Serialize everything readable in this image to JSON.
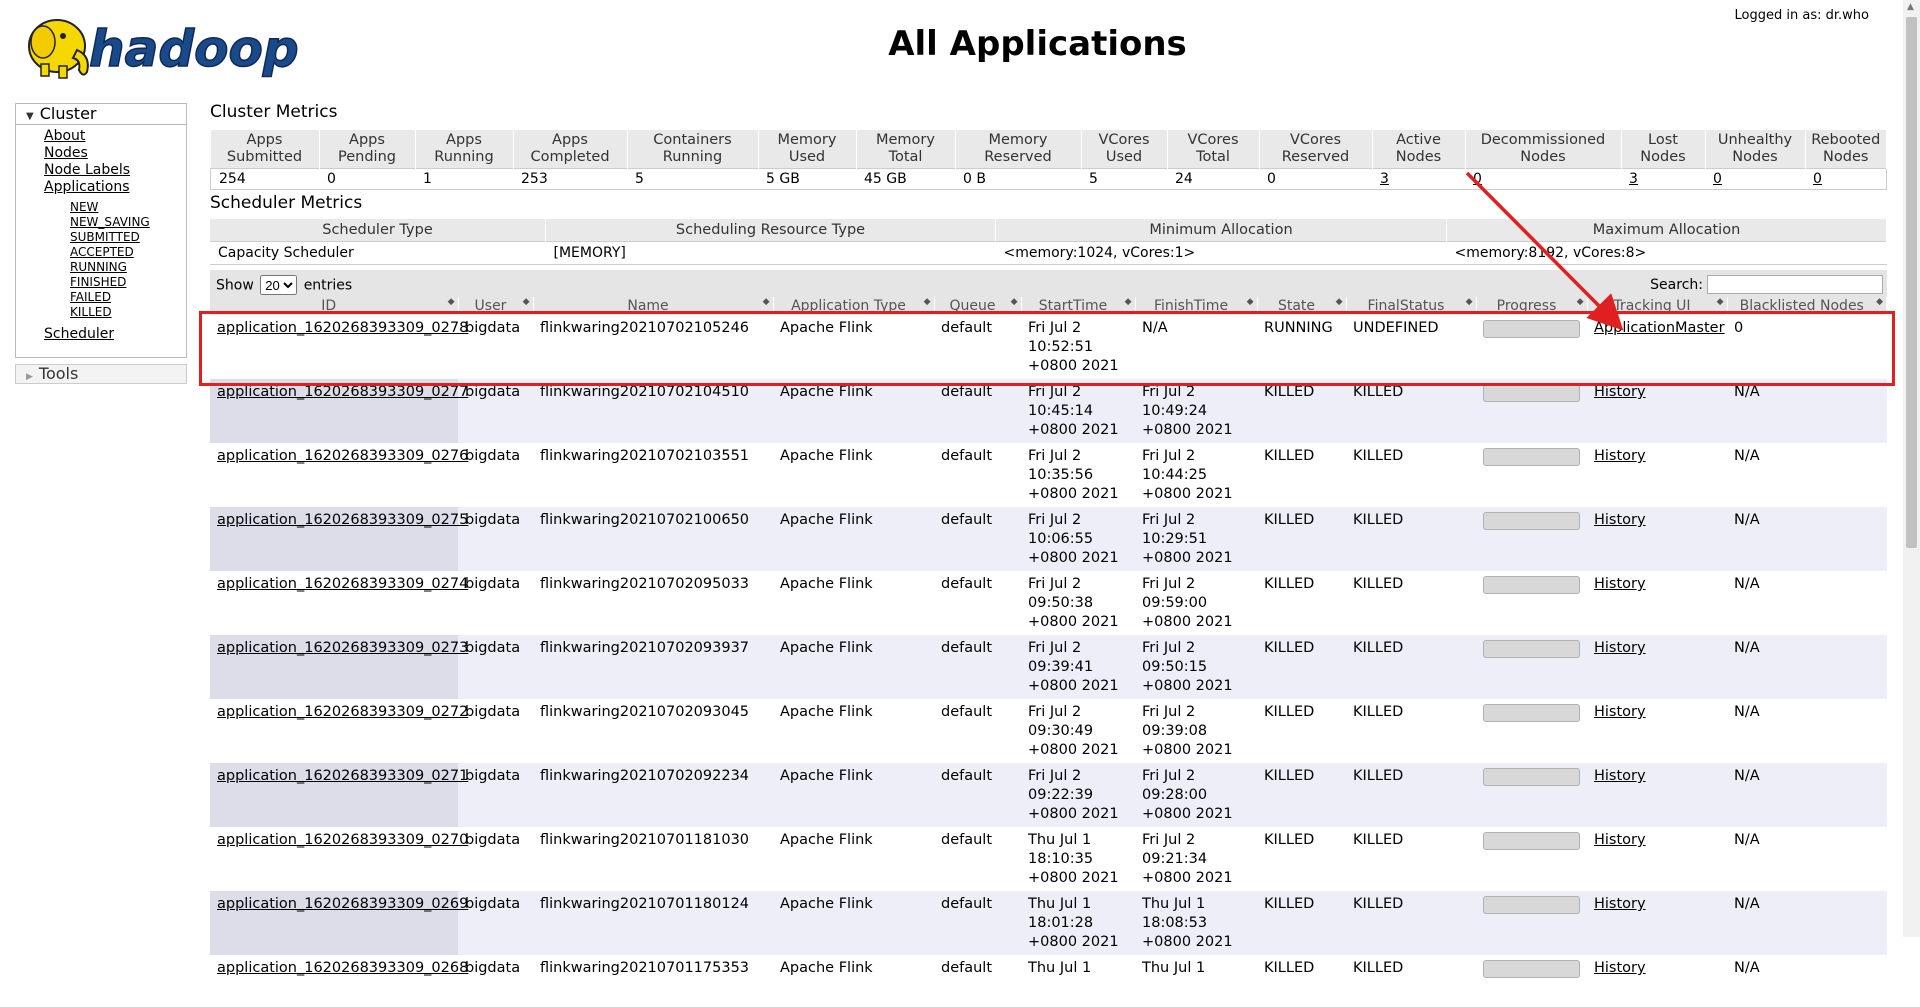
{
  "header": {
    "logo_text": "hadoop",
    "title": "All Applications",
    "logged_in": "Logged in as: dr.who"
  },
  "nav": {
    "cluster_label": "Cluster",
    "items": [
      "About",
      "Nodes",
      "Node Labels",
      "Applications"
    ],
    "app_states": [
      "NEW",
      "NEW_SAVING",
      "SUBMITTED",
      "ACCEPTED",
      "RUNNING",
      "FINISHED",
      "FAILED",
      "KILLED"
    ],
    "scheduler_label": "Scheduler",
    "tools_label": "Tools"
  },
  "cluster_metrics": {
    "title": "Cluster Metrics",
    "headers": [
      "Apps Submitted",
      "Apps Pending",
      "Apps Running",
      "Apps Completed",
      "Containers Running",
      "Memory Used",
      "Memory Total",
      "Memory Reserved",
      "VCores Used",
      "VCores Total",
      "VCores Reserved",
      "Active Nodes",
      "Decommissioned Nodes",
      "Lost Nodes",
      "Unhealthy Nodes",
      "Rebooted Nodes"
    ],
    "values": [
      "254",
      "0",
      "1",
      "253",
      "5",
      "5 GB",
      "45 GB",
      "0 B",
      "5",
      "24",
      "0",
      "3",
      "0",
      "3",
      "0",
      "0"
    ]
  },
  "scheduler_metrics": {
    "title": "Scheduler Metrics",
    "headers": [
      "Scheduler Type",
      "Scheduling Resource Type",
      "Minimum Allocation",
      "Maximum Allocation"
    ],
    "values": [
      "Capacity Scheduler",
      "[MEMORY]",
      "<memory:1024, vCores:1>",
      "<memory:8192, vCores:8>"
    ]
  },
  "apps": {
    "show_label": "Show",
    "entries_value": "20",
    "entries_label": "entries",
    "search_label": "Search:",
    "columns": [
      "ID",
      "User",
      "Name",
      "Application Type",
      "Queue",
      "StartTime",
      "FinishTime",
      "State",
      "FinalStatus",
      "Progress",
      "Tracking UI",
      "Blacklisted Nodes"
    ],
    "rows": [
      {
        "id": "application_1620268393309_0278",
        "user": "bigdata",
        "name": "flinkwaring20210702105246",
        "type": "Apache Flink",
        "queue": "default",
        "start": "Fri Jul 2 10:52:51 +0800 2021",
        "finish": "N/A",
        "state": "RUNNING",
        "final": "UNDEFINED",
        "tracking": "ApplicationMaster",
        "blacklisted": "0"
      },
      {
        "id": "application_1620268393309_0277",
        "user": "bigdata",
        "name": "flinkwaring20210702104510",
        "type": "Apache Flink",
        "queue": "default",
        "start": "Fri Jul 2 10:45:14 +0800 2021",
        "finish": "Fri Jul 2 10:49:24 +0800 2021",
        "state": "KILLED",
        "final": "KILLED",
        "tracking": "History",
        "blacklisted": "N/A"
      },
      {
        "id": "application_1620268393309_0276",
        "user": "bigdata",
        "name": "flinkwaring20210702103551",
        "type": "Apache Flink",
        "queue": "default",
        "start": "Fri Jul 2 10:35:56 +0800 2021",
        "finish": "Fri Jul 2 10:44:25 +0800 2021",
        "state": "KILLED",
        "final": "KILLED",
        "tracking": "History",
        "blacklisted": "N/A"
      },
      {
        "id": "application_1620268393309_0275",
        "user": "bigdata",
        "name": "flinkwaring20210702100650",
        "type": "Apache Flink",
        "queue": "default",
        "start": "Fri Jul 2 10:06:55 +0800 2021",
        "finish": "Fri Jul 2 10:29:51 +0800 2021",
        "state": "KILLED",
        "final": "KILLED",
        "tracking": "History",
        "blacklisted": "N/A"
      },
      {
        "id": "application_1620268393309_0274",
        "user": "bigdata",
        "name": "flinkwaring20210702095033",
        "type": "Apache Flink",
        "queue": "default",
        "start": "Fri Jul 2 09:50:38 +0800 2021",
        "finish": "Fri Jul 2 09:59:00 +0800 2021",
        "state": "KILLED",
        "final": "KILLED",
        "tracking": "History",
        "blacklisted": "N/A"
      },
      {
        "id": "application_1620268393309_0273",
        "user": "bigdata",
        "name": "flinkwaring20210702093937",
        "type": "Apache Flink",
        "queue": "default",
        "start": "Fri Jul 2 09:39:41 +0800 2021",
        "finish": "Fri Jul 2 09:50:15 +0800 2021",
        "state": "KILLED",
        "final": "KILLED",
        "tracking": "History",
        "blacklisted": "N/A"
      },
      {
        "id": "application_1620268393309_0272",
        "user": "bigdata",
        "name": "flinkwaring20210702093045",
        "type": "Apache Flink",
        "queue": "default",
        "start": "Fri Jul 2 09:30:49 +0800 2021",
        "finish": "Fri Jul 2 09:39:08 +0800 2021",
        "state": "KILLED",
        "final": "KILLED",
        "tracking": "History",
        "blacklisted": "N/A"
      },
      {
        "id": "application_1620268393309_0271",
        "user": "bigdata",
        "name": "flinkwaring20210702092234",
        "type": "Apache Flink",
        "queue": "default",
        "start": "Fri Jul 2 09:22:39 +0800 2021",
        "finish": "Fri Jul 2 09:28:00 +0800 2021",
        "state": "KILLED",
        "final": "KILLED",
        "tracking": "History",
        "blacklisted": "N/A"
      },
      {
        "id": "application_1620268393309_0270",
        "user": "bigdata",
        "name": "flinkwaring20210701181030",
        "type": "Apache Flink",
        "queue": "default",
        "start": "Thu Jul 1 18:10:35 +0800 2021",
        "finish": "Fri Jul 2 09:21:34 +0800 2021",
        "state": "KILLED",
        "final": "KILLED",
        "tracking": "History",
        "blacklisted": "N/A"
      },
      {
        "id": "application_1620268393309_0269",
        "user": "bigdata",
        "name": "flinkwaring20210701180124",
        "type": "Apache Flink",
        "queue": "default",
        "start": "Thu Jul 1 18:01:28 +0800 2021",
        "finish": "Thu Jul 1 18:08:53 +0800 2021",
        "state": "KILLED",
        "final": "KILLED",
        "tracking": "History",
        "blacklisted": "N/A"
      },
      {
        "id": "application_1620268393309_0268",
        "user": "bigdata",
        "name": "flinkwaring20210701175353",
        "type": "Apache Flink",
        "queue": "default",
        "start": "Thu Jul 1",
        "finish": "Thu Jul 1",
        "state": "KILLED",
        "final": "KILLED",
        "tracking": "History",
        "blacklisted": "N/A"
      }
    ]
  },
  "colors": {
    "annotation": "#e02020",
    "header_bg": "#e5e5e5",
    "even_row_bg": "#eeeef8",
    "logo_yellow": "#f5d800",
    "logo_blue": "#1a4a8a"
  },
  "icons": {
    "logo": "hadoop-elephant-logo",
    "sort": "sort-arrows-icon",
    "expand": "triangle-down-icon",
    "collapse": "triangle-right-icon"
  }
}
